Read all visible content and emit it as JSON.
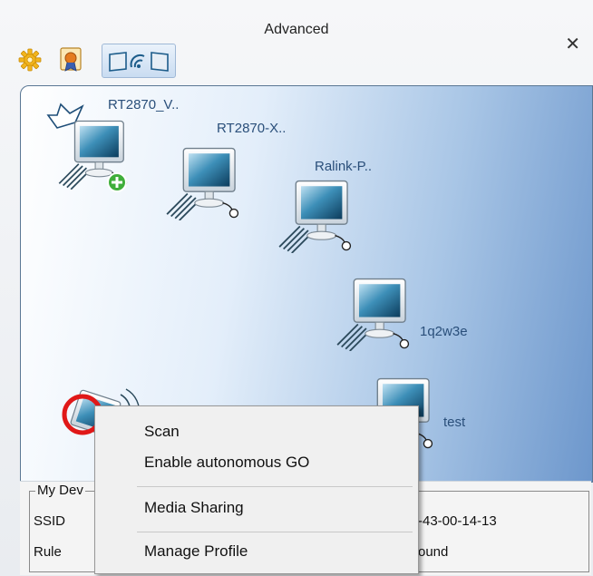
{
  "window": {
    "title": "Advanced",
    "close_icon": "close-icon"
  },
  "toolbar": {
    "icons": [
      "gear-icon",
      "certificate-icon",
      "wifi-direct-icon"
    ],
    "active": "wifi-direct-icon"
  },
  "devices": [
    {
      "label": "RT2870_V..",
      "icon": "computer-crown-add-icon"
    },
    {
      "label": "RT2870-X..",
      "icon": "computer-icon"
    },
    {
      "label": "Ralink-P..",
      "icon": "computer-icon"
    },
    {
      "label": "1q2w3e",
      "icon": "computer-icon"
    },
    {
      "label": "test",
      "icon": "computer-icon"
    }
  ],
  "my_device": {
    "icon": "my-device-wireless-icon",
    "highlight": "red-circle"
  },
  "info_panel": {
    "legend": "My Dev",
    "ssid_label": "SSID",
    "rule_label": "Rule",
    "ssid_value_fragment": "-43-00-14-13",
    "rule_value_fragment": "ound"
  },
  "context_menu": {
    "items": [
      "Scan",
      "Enable autonomous GO",
      "Media Sharing",
      "Manage Profile"
    ]
  },
  "colors": {
    "highlight_ring": "#e01818",
    "canvas_accent": "#6d97cc",
    "label_text": "#2a4f7a"
  }
}
